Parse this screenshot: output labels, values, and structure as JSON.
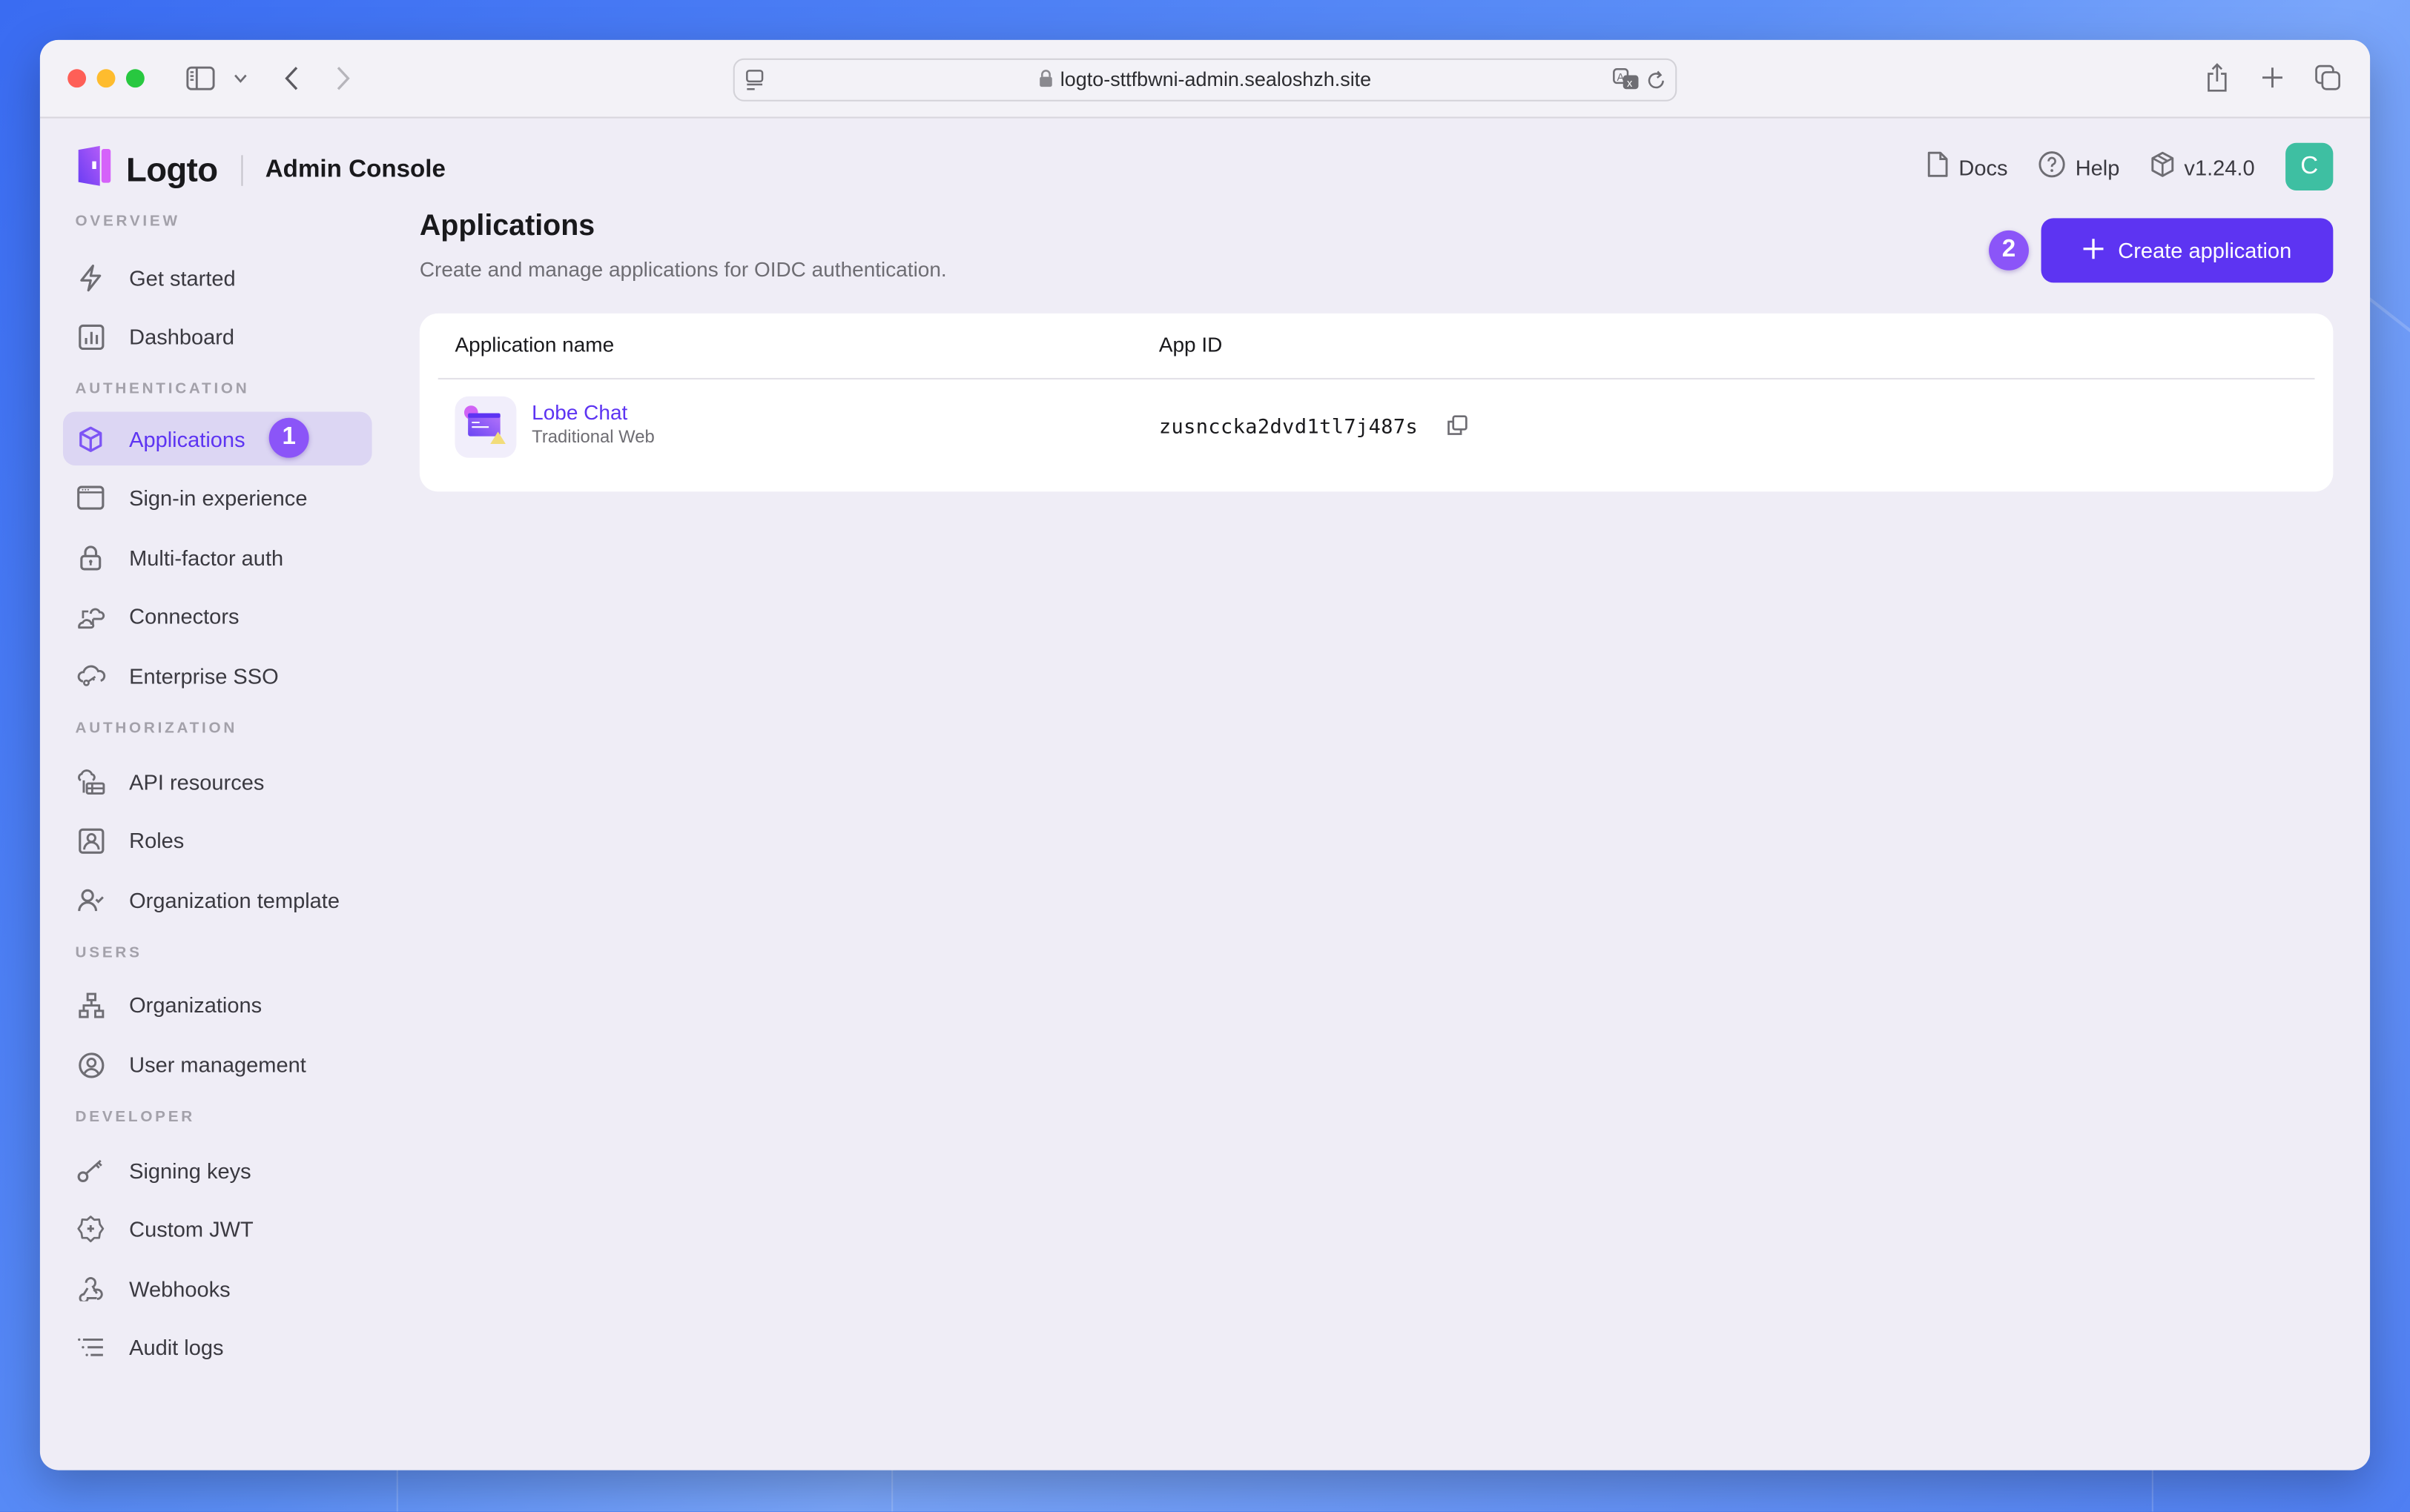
{
  "browser": {
    "url": "logto-sttfbwni-admin.sealoshzh.site"
  },
  "header": {
    "brand": "Logto",
    "console": "Admin Console",
    "links": [
      {
        "label": "Docs",
        "icon": "document-icon"
      },
      {
        "label": "Help",
        "icon": "help-circle-icon"
      },
      {
        "label": "v1.24.0",
        "icon": "box-icon"
      }
    ],
    "avatar_initial": "C",
    "avatar_color": "#3ebfa2"
  },
  "sidebar": {
    "sections": [
      {
        "title": "OVERVIEW",
        "items": [
          {
            "label": "Get started",
            "icon": "lightning-icon"
          },
          {
            "label": "Dashboard",
            "icon": "bar-chart-icon"
          }
        ]
      },
      {
        "title": "AUTHENTICATION",
        "items": [
          {
            "label": "Applications",
            "icon": "cube-icon",
            "active": true,
            "badge": "1"
          },
          {
            "label": "Sign-in experience",
            "icon": "browser-window-icon"
          },
          {
            "label": "Multi-factor auth",
            "icon": "lock-icon"
          },
          {
            "label": "Connectors",
            "icon": "cloud-connector-icon"
          },
          {
            "label": "Enterprise SSO",
            "icon": "cloud-key-icon"
          }
        ]
      },
      {
        "title": "AUTHORIZATION",
        "items": [
          {
            "label": "API resources",
            "icon": "cloud-database-icon"
          },
          {
            "label": "Roles",
            "icon": "user-badge-icon"
          },
          {
            "label": "Organization template",
            "icon": "user-check-icon"
          }
        ]
      },
      {
        "title": "USERS",
        "items": [
          {
            "label": "Organizations",
            "icon": "hierarchy-icon"
          },
          {
            "label": "User management",
            "icon": "user-circle-icon"
          }
        ]
      },
      {
        "title": "DEVELOPER",
        "items": [
          {
            "label": "Signing keys",
            "icon": "key-icon"
          },
          {
            "label": "Custom JWT",
            "icon": "badge-plus-icon"
          },
          {
            "label": "Webhooks",
            "icon": "webhook-icon"
          },
          {
            "label": "Audit logs",
            "icon": "list-icon"
          }
        ]
      }
    ]
  },
  "main": {
    "title": "Applications",
    "subtitle": "Create and manage applications for OIDC authentication.",
    "create_button": "Create application",
    "step_badge": "2",
    "table": {
      "columns": [
        "Application name",
        "App ID"
      ],
      "rows": [
        {
          "name": "Lobe Chat",
          "type": "Traditional Web",
          "app_id": "zusnccka2dvd1tl7j487s"
        }
      ]
    }
  },
  "colors": {
    "accent": "#5d34f2",
    "badge": "#8b55f8",
    "active_bg": "#dcd6f3"
  }
}
